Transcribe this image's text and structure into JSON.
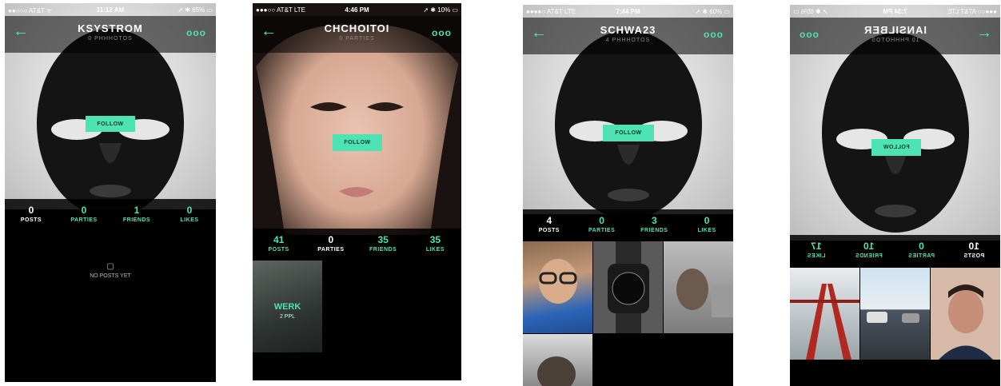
{
  "colors": {
    "accent": "#4ee3b3",
    "background": "#000000"
  },
  "screens": [
    {
      "status": {
        "carrier": "●●○○○ AT&T ᯤ",
        "time": "11:12 AM",
        "battery": "➚ ✱ 65% ▭"
      },
      "username": "KSYSTROM",
      "subtitle": "0 PHHHOTOS",
      "follow_label": "FOLLOW",
      "stats": [
        {
          "value": "0",
          "label": "POSTS"
        },
        {
          "value": "0",
          "label": "PARTIES"
        },
        {
          "value": "1",
          "label": "FRIENDS"
        },
        {
          "value": "0",
          "label": "LIKES"
        }
      ],
      "empty_text": "NO POSTS YET"
    },
    {
      "status": {
        "carrier": "●●●○○ AT&T LTE",
        "time": "4:46 PM",
        "battery": "➚ ✱ 10% ▭"
      },
      "username": "CHCHOITOI",
      "subtitle": "0 PARTIES",
      "follow_label": "FOLLOW",
      "stats": [
        {
          "value": "41",
          "label": "POSTS"
        },
        {
          "value": "0",
          "label": "PARTIES"
        },
        {
          "value": "35",
          "label": "FRIENDS"
        },
        {
          "value": "35",
          "label": "LIKES"
        }
      ],
      "party": {
        "name": "WERK",
        "count": "2 PPL"
      }
    },
    {
      "status": {
        "carrier": "●●●●○ AT&T LTE",
        "time": "7:44 PM",
        "battery": "➚ ✱ 60% ▭"
      },
      "username": "SCHWA23",
      "subtitle": "4 PHHHOTOS",
      "follow_label": "FOLLOW",
      "stats": [
        {
          "value": "4",
          "label": "POSTS"
        },
        {
          "value": "0",
          "label": "PARTIES"
        },
        {
          "value": "3",
          "label": "FRIENDS"
        },
        {
          "value": "0",
          "label": "LIKES"
        }
      ]
    },
    {
      "status": {
        "carrier": "●●●○○ AT&T LTE",
        "time": "7:34 PM",
        "battery": "➚ ✱ 65% ▭"
      },
      "username": "IANSILBER",
      "subtitle": "10 PHHHOTOS",
      "follow_label": "FOLLOW",
      "stats": [
        {
          "value": "10",
          "label": "POSTS"
        },
        {
          "value": "0",
          "label": "PARTIES"
        },
        {
          "value": "10",
          "label": "FRIENDS"
        },
        {
          "value": "17",
          "label": "LIKES"
        }
      ]
    }
  ]
}
